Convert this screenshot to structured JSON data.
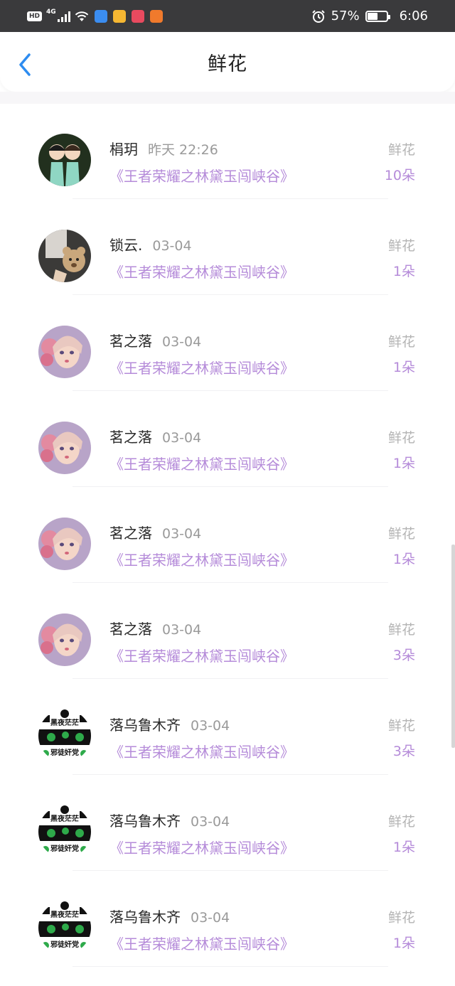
{
  "status_bar": {
    "hd": "HD",
    "network": "4G",
    "battery_percent": "57%",
    "battery_level": 0.57,
    "time": "6:06"
  },
  "header": {
    "title": "鲜花",
    "back_icon": "chevron-left-icon"
  },
  "items": [
    {
      "name": "梋玥",
      "time": "昨天 22:26",
      "book": "《王者荣耀之林黛玉闯峡谷》",
      "gift": "鲜花",
      "count": "10朵",
      "avatar": "cartoon-pair"
    },
    {
      "name": "锁云.",
      "time": "03-04",
      "book": "《王者荣耀之林黛玉闯峡谷》",
      "gift": "鲜花",
      "count": "1朵",
      "avatar": "teddy-bear"
    },
    {
      "name": "茗之落",
      "time": "03-04",
      "book": "《王者荣耀之林黛玉闯峡谷》",
      "gift": "鲜花",
      "count": "1朵",
      "avatar": "anime-girl"
    },
    {
      "name": "茗之落",
      "time": "03-04",
      "book": "《王者荣耀之林黛玉闯峡谷》",
      "gift": "鲜花",
      "count": "1朵",
      "avatar": "anime-girl"
    },
    {
      "name": "茗之落",
      "time": "03-04",
      "book": "《王者荣耀之林黛玉闯峡谷》",
      "gift": "鲜花",
      "count": "1朵",
      "avatar": "anime-girl"
    },
    {
      "name": "茗之落",
      "time": "03-04",
      "book": "《王者荣耀之林黛玉闯峡谷》",
      "gift": "鲜花",
      "count": "3朵",
      "avatar": "anime-girl"
    },
    {
      "name": "落乌鲁木齐",
      "time": "03-04",
      "book": "《王者荣耀之林黛玉闯峡谷》",
      "gift": "鲜花",
      "count": "3朵",
      "avatar": "frog-meme",
      "avatar_text_top": "黑夜茫茫",
      "avatar_text_bottom": "邪徒奸党"
    },
    {
      "name": "落乌鲁木齐",
      "time": "03-04",
      "book": "《王者荣耀之林黛玉闯峡谷》",
      "gift": "鲜花",
      "count": "1朵",
      "avatar": "frog-meme",
      "avatar_text_top": "黑夜茫茫",
      "avatar_text_bottom": "邪徒奸党"
    },
    {
      "name": "落乌鲁木齐",
      "time": "03-04",
      "book": "《王者荣耀之林黛玉闯峡谷》",
      "gift": "鲜花",
      "count": "1朵",
      "avatar": "frog-meme",
      "avatar_text_top": "黑夜茫茫",
      "avatar_text_bottom": "邪徒奸党"
    }
  ]
}
